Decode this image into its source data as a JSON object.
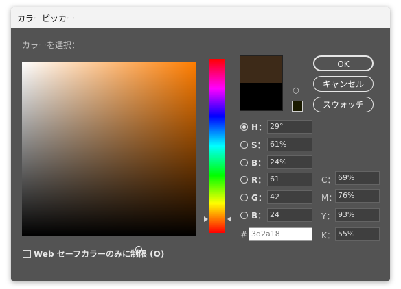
{
  "window": {
    "title": "カラーピッカー"
  },
  "picker": {
    "select_label": "カラーを選択："
  },
  "buttons": {
    "ok": "OK",
    "cancel": "キャンセル",
    "swatches": "スウォッチ"
  },
  "colors": {
    "new": "#3d2a18",
    "old": "#000000",
    "hue": "#ff7d00",
    "web_swatch": "#1a1a00"
  },
  "hsb": {
    "h": {
      "label": "H：",
      "value": "29°"
    },
    "s": {
      "label": "S：",
      "value": "61%"
    },
    "b": {
      "label": "B：",
      "value": "24%"
    }
  },
  "rgb": {
    "r": {
      "label": "R：",
      "value": "61"
    },
    "g": {
      "label": "G：",
      "value": "42"
    },
    "b": {
      "label": "B：",
      "value": "24"
    }
  },
  "hex": {
    "label": "#",
    "value": "3d2a18"
  },
  "cmyk": {
    "c": {
      "label": "C：",
      "value": "69%"
    },
    "m": {
      "label": "M：",
      "value": "76%"
    },
    "y": {
      "label": "Y：",
      "value": "93%"
    },
    "k": {
      "label": "K：",
      "value": "55%"
    }
  },
  "web_only": {
    "label": "Web セーフカラーのみに制限 (O)",
    "checked": false
  },
  "icons": {
    "cube": "cube-icon"
  }
}
